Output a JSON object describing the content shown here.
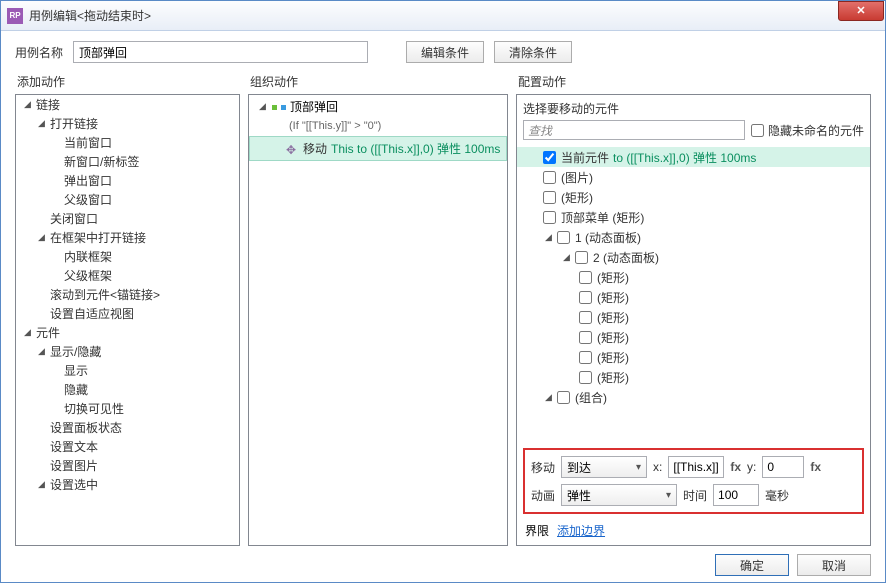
{
  "window": {
    "title": "用例编辑<拖动结束时>",
    "app_icon": "RP"
  },
  "top": {
    "case_label": "用例名称",
    "case_value": "顶部弹回",
    "edit_cond": "编辑条件",
    "clear_cond": "清除条件"
  },
  "headers": {
    "add": "添加动作",
    "org": "组织动作",
    "cfg": "配置动作"
  },
  "actions_tree": [
    {
      "label": "链接",
      "indent": 0,
      "open": true
    },
    {
      "label": "打开链接",
      "indent": 1,
      "open": true
    },
    {
      "label": "当前窗口",
      "indent": 2
    },
    {
      "label": "新窗口/新标签",
      "indent": 2
    },
    {
      "label": "弹出窗口",
      "indent": 2
    },
    {
      "label": "父级窗口",
      "indent": 2
    },
    {
      "label": "关闭窗口",
      "indent": 1
    },
    {
      "label": "在框架中打开链接",
      "indent": 1,
      "open": true
    },
    {
      "label": "内联框架",
      "indent": 2
    },
    {
      "label": "父级框架",
      "indent": 2
    },
    {
      "label": "滚动到元件<锚链接>",
      "indent": 1
    },
    {
      "label": "设置自适应视图",
      "indent": 1
    },
    {
      "label": "元件",
      "indent": 0,
      "open": true
    },
    {
      "label": "显示/隐藏",
      "indent": 1,
      "open": true
    },
    {
      "label": "显示",
      "indent": 2
    },
    {
      "label": "隐藏",
      "indent": 2
    },
    {
      "label": "切换可见性",
      "indent": 2
    },
    {
      "label": "设置面板状态",
      "indent": 1
    },
    {
      "label": "设置文本",
      "indent": 1
    },
    {
      "label": "设置图片",
      "indent": 1
    },
    {
      "label": "设置选中",
      "indent": 1,
      "open": true
    }
  ],
  "org": {
    "case_name": "顶部弹回",
    "condition": "(If \"[[This.y]]\" > \"0\")",
    "action_label": "移动",
    "action_param": "This to ([[This.x]],0) 弹性 100ms"
  },
  "cfg": {
    "sel_label": "选择要移动的元件",
    "search_placeholder": "查找",
    "hide_unnamed": "隐藏未命名的元件",
    "widgets": [
      {
        "label": "当前元件",
        "param": "to ([[This.x]],0) 弹性 100ms",
        "checked": true,
        "hl": true,
        "indent": 1
      },
      {
        "label": "(图片)",
        "indent": 1
      },
      {
        "label": "(矩形)",
        "indent": 1
      },
      {
        "label": "顶部菜单 (矩形)",
        "indent": 1
      },
      {
        "label": "1 (动态面板)",
        "indent": 1,
        "open": true,
        "arrow": true
      },
      {
        "label": "2 (动态面板)",
        "indent": 2,
        "open": true,
        "arrow": true
      },
      {
        "label": "(矩形)",
        "indent": 3
      },
      {
        "label": "(矩形)",
        "indent": 3
      },
      {
        "label": "(矩形)",
        "indent": 3
      },
      {
        "label": "(矩形)",
        "indent": 3
      },
      {
        "label": "(矩形)",
        "indent": 3
      },
      {
        "label": "(矩形)",
        "indent": 3
      },
      {
        "label": "(组合)",
        "indent": 1,
        "open": true,
        "arrow": true
      }
    ],
    "move_label": "移动",
    "move_mode": "到达",
    "x_label": "x:",
    "x_value": "[[This.x]]",
    "y_label": "y:",
    "y_value": "0",
    "anim_label": "动画",
    "anim_mode": "弹性",
    "time_label": "时间",
    "time_value": "100",
    "time_unit": "毫秒",
    "limit_label": "界限",
    "limit_link": "添加边界"
  },
  "footer": {
    "ok": "确定",
    "cancel": "取消"
  }
}
